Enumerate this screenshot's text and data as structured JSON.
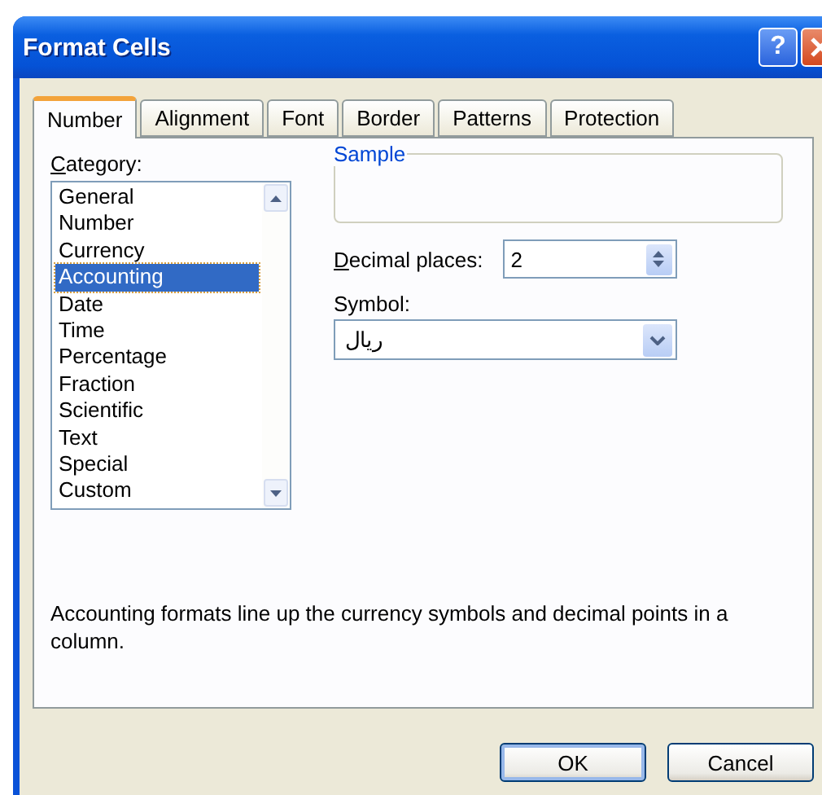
{
  "window": {
    "title": "Format Cells",
    "help": "?"
  },
  "tabs": [
    {
      "label": "Number",
      "selected": true
    },
    {
      "label": "Alignment",
      "selected": false
    },
    {
      "label": "Font",
      "selected": false
    },
    {
      "label": "Border",
      "selected": false
    },
    {
      "label": "Patterns",
      "selected": false
    },
    {
      "label": "Protection",
      "selected": false
    }
  ],
  "category": {
    "label": "Category:",
    "items": [
      {
        "label": "General",
        "selected": false
      },
      {
        "label": "Number",
        "selected": false
      },
      {
        "label": "Currency",
        "selected": false
      },
      {
        "label": "Accounting",
        "selected": true
      },
      {
        "label": "Date",
        "selected": false
      },
      {
        "label": "Time",
        "selected": false
      },
      {
        "label": "Percentage",
        "selected": false
      },
      {
        "label": "Fraction",
        "selected": false
      },
      {
        "label": "Scientific",
        "selected": false
      },
      {
        "label": "Text",
        "selected": false
      },
      {
        "label": "Special",
        "selected": false
      },
      {
        "label": "Custom",
        "selected": false
      }
    ]
  },
  "sample": {
    "label": "Sample"
  },
  "decimal_places": {
    "label": "Decimal places:",
    "value": "2"
  },
  "symbol": {
    "label": "Symbol:",
    "value": "ريال"
  },
  "description": "Accounting formats line up the currency symbols and decimal points in a column.",
  "buttons": [
    "OK",
    "Cancel"
  ]
}
